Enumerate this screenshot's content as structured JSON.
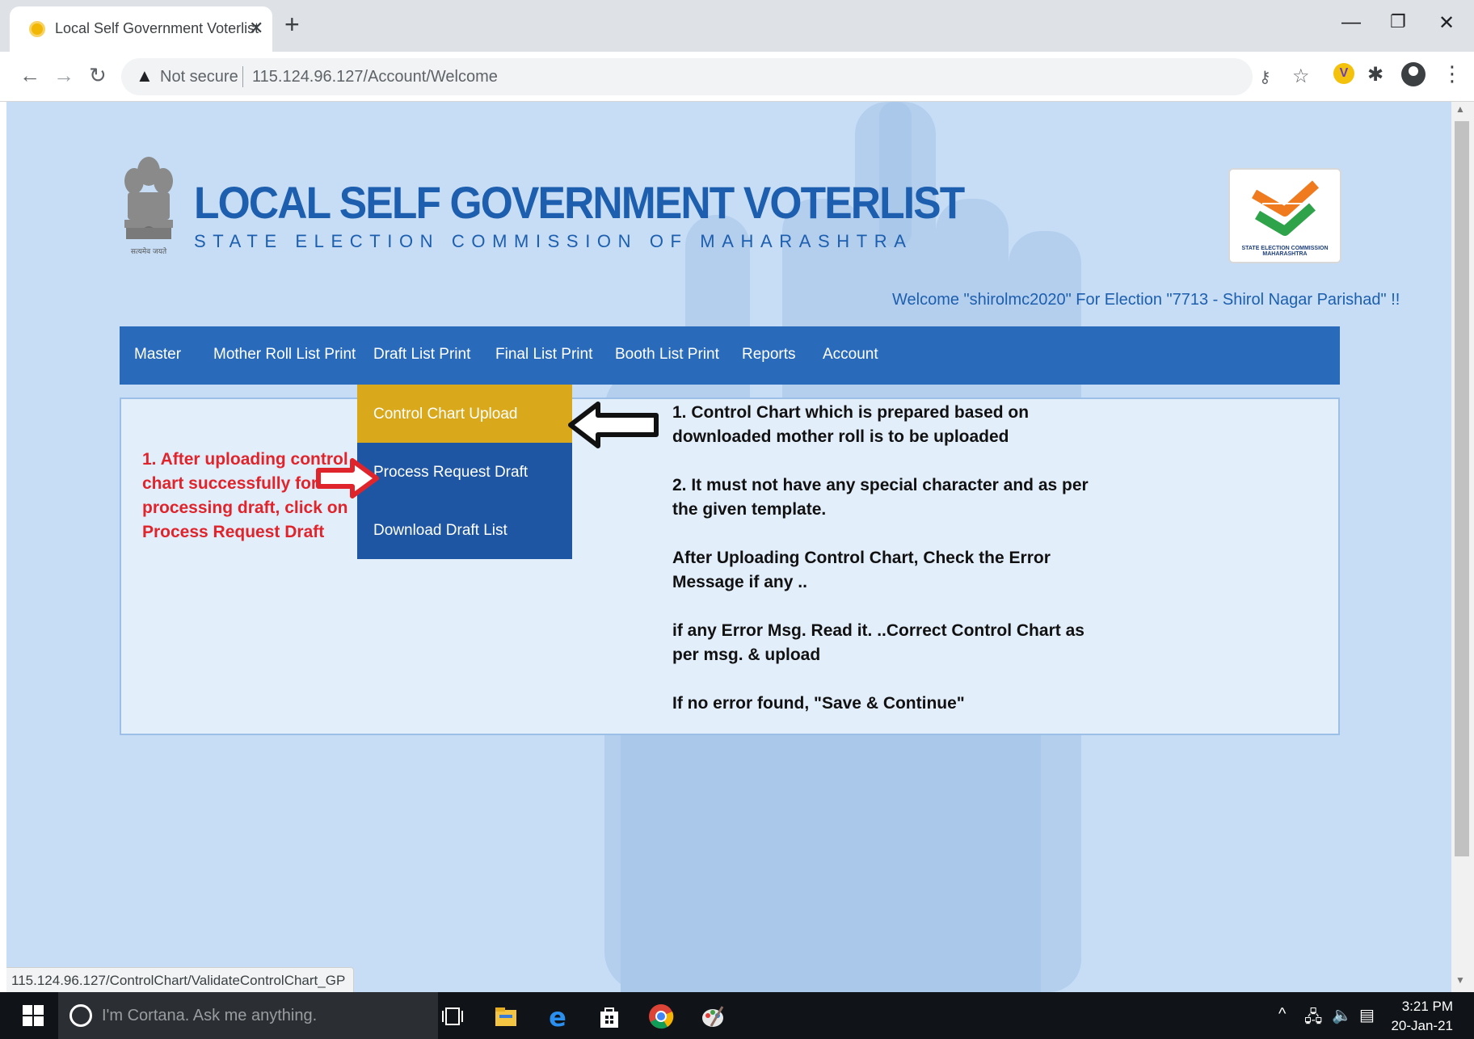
{
  "browser": {
    "tab_title": "Local Self Government Voterlist",
    "security_label": "Not secure",
    "url": "115.124.96.127/Account/Welcome",
    "status_url": "115.124.96.127/ControlChart/ValidateControlChart_GP"
  },
  "header": {
    "emblem_caption": "सत्यमेव जयते",
    "title": "LOCAL SELF GOVERNMENT VOTERLIST",
    "subtitle": "STATE ELECTION COMMISSION OF MAHARASHTRA",
    "logo_text": "STATE ELECTION COMMISSION MAHARASHTRA",
    "welcome": "Welcome \"shirolmc2020\" For Election \"7713 - Shirol Nagar Parishad\" !!"
  },
  "nav": {
    "items": [
      {
        "label": "Master"
      },
      {
        "label": "Mother Roll List Print"
      },
      {
        "label": "Draft List Print"
      },
      {
        "label": "Final List Print"
      },
      {
        "label": "Booth List Print"
      },
      {
        "label": "Reports"
      },
      {
        "label": "Account"
      }
    ]
  },
  "dropdown": {
    "items": [
      {
        "label": "Control Chart Upload",
        "active": true
      },
      {
        "label": "Process Request Draft",
        "active": false
      },
      {
        "label": "Download Draft List",
        "active": false
      }
    ]
  },
  "annotations": {
    "left_note": "1. After uploading control chart successfully for processing draft, click on Process Request Draft",
    "right_notes": [
      "1. Control Chart which is  prepared based on downloaded mother roll is to be uploaded",
      "2. It must not have any special character and as per the given template.",
      "After Uploading Control Chart, Check the Error Message if any ..",
      "if any Error Msg. Read it. ..Correct Control Chart as per msg. & upload",
      "If no error found, \"Save & Continue\""
    ]
  },
  "taskbar": {
    "search_placeholder": "I'm Cortana. Ask me anything.",
    "time": "3:21 PM",
    "date": "20-Jan-21"
  },
  "colors": {
    "brand_blue": "#1d5fae",
    "nav_blue": "#2a6aba",
    "dropdown_blue": "#1f56a3",
    "dropdown_active": "#d9a81b",
    "annotation_red": "#e0242b"
  }
}
